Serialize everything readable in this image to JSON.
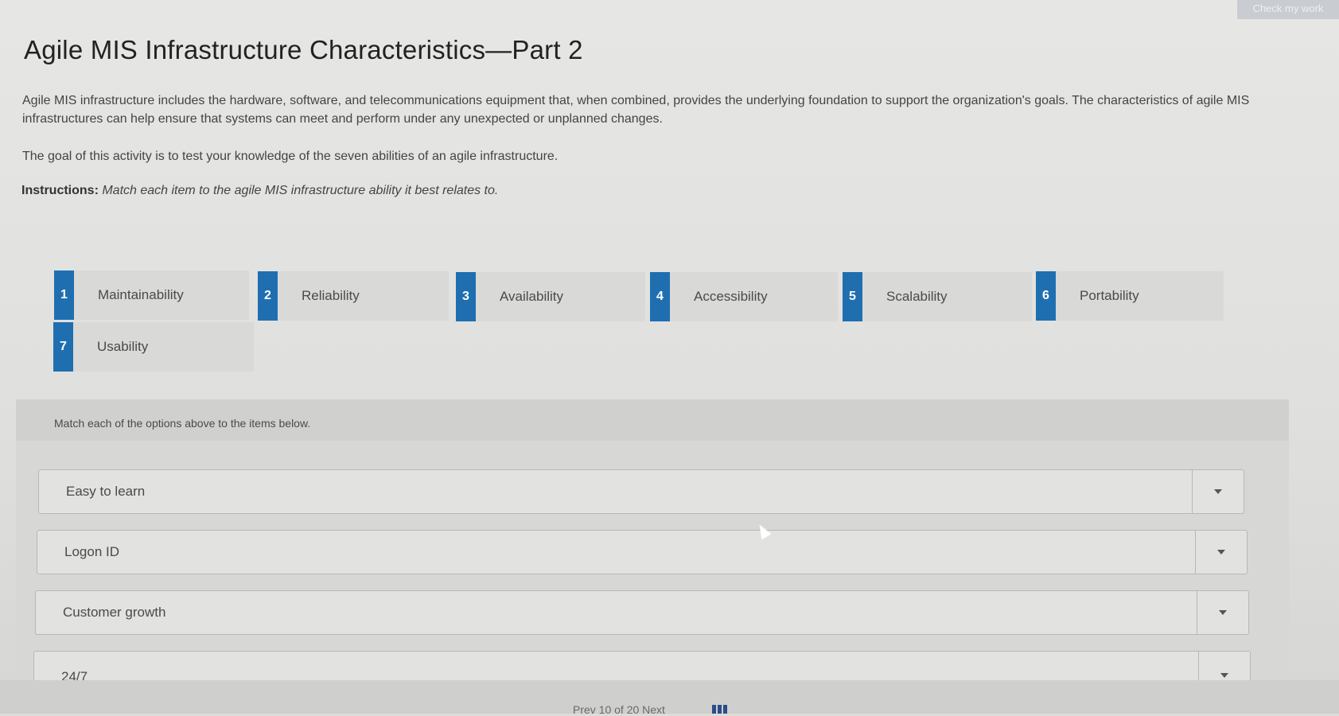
{
  "header": {
    "check_button": "Check my work",
    "title": "Agile MIS Infrastructure Characteristics—Part 2",
    "intro": "Agile MIS infrastructure includes the hardware, software, and telecommunications equipment that, when combined, provides the underlying foundation to support the organization's goals. The characteristics of agile MIS infrastructures can help ensure that systems can meet and perform under any unexpected or unplanned changes.",
    "goal": "The goal of this activity is to test your knowledge of the seven abilities of an agile infrastructure.",
    "instructions_label": "Instructions:",
    "instructions_text": "Match each item to the agile MIS infrastructure ability it best relates to."
  },
  "options": [
    {
      "num": "1",
      "label": "Maintainability"
    },
    {
      "num": "2",
      "label": "Reliability"
    },
    {
      "num": "3",
      "label": "Availability"
    },
    {
      "num": "4",
      "label": "Accessibility"
    },
    {
      "num": "5",
      "label": "Scalability"
    },
    {
      "num": "6",
      "label": "Portability"
    },
    {
      "num": "7",
      "label": "Usability"
    }
  ],
  "match": {
    "note": "Match each of the options above to the items below.",
    "items": [
      {
        "label": "Easy to learn"
      },
      {
        "label": "Logon ID"
      },
      {
        "label": "Customer growth"
      },
      {
        "label": "24/7"
      }
    ]
  },
  "footer": {
    "text": "Prev    10 of 20    Next"
  },
  "colors": {
    "accent": "#1f6fb0",
    "chip_bg": "#d9d9d7"
  },
  "icons": {
    "dropdown": "caret-down-icon",
    "grid": "grid-icon",
    "cursor": "pointer-cursor-icon"
  }
}
